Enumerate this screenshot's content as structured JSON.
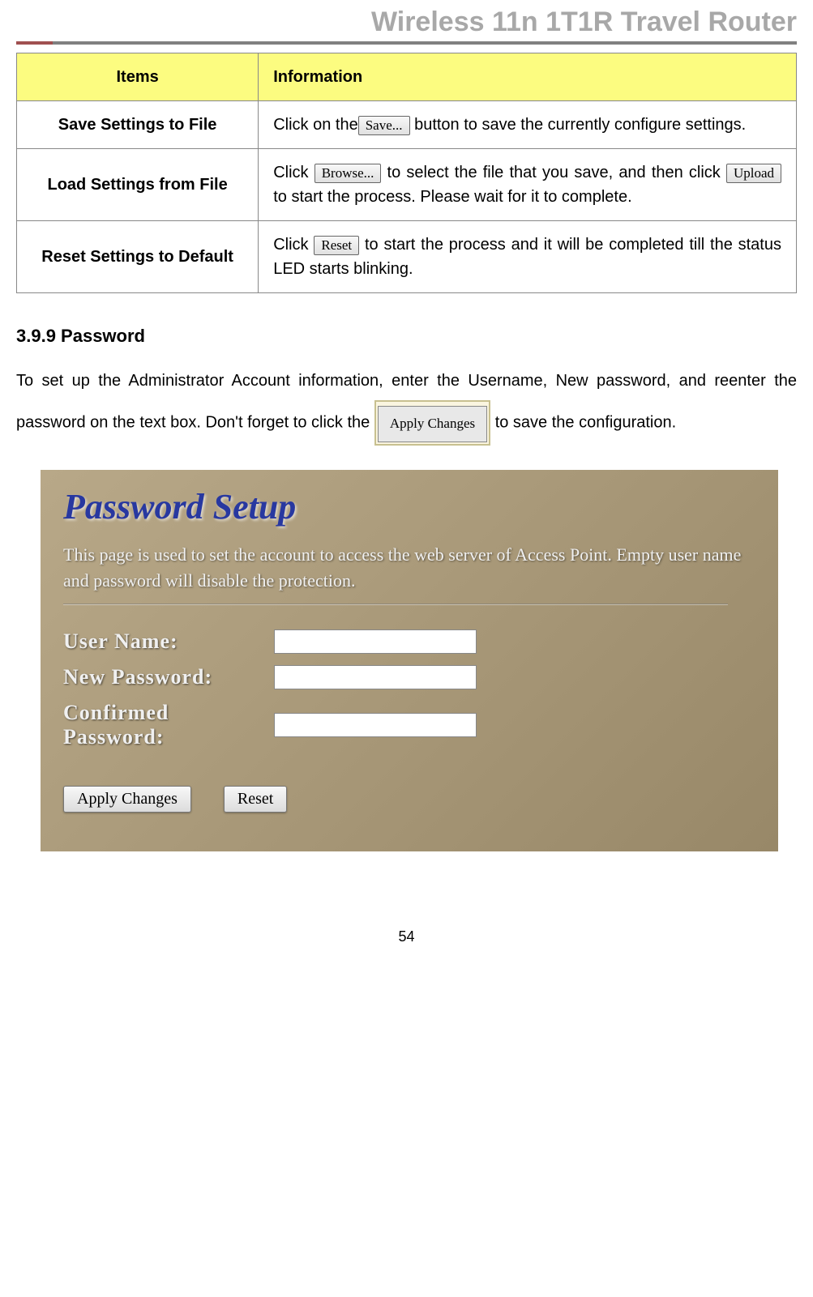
{
  "header": {
    "title": "Wireless 11n 1T1R Travel Router"
  },
  "table": {
    "headers": {
      "items": "Items",
      "info": "Information"
    },
    "rows": [
      {
        "item": "Save Settings to File",
        "info_before": "Click on the",
        "btn1": "Save...",
        "info_after": " button to save the currently configure settings."
      },
      {
        "item": "Load Settings from File",
        "info_part1": "Click ",
        "btn1": "Browse...",
        "info_part2": " to select the file that you save, and then click ",
        "btn2": "Upload",
        "info_part3": " to start the process. Please wait for it to complete."
      },
      {
        "item": "Reset Settings to Default",
        "info_before": "Click ",
        "btn1": "Reset",
        "info_after": " to start the process and it will be completed till the status LED starts blinking."
      }
    ]
  },
  "section": {
    "heading": "3.9.9   Password",
    "text_part1": "To set up the Administrator Account information, enter the Username, New password, and reenter the password on the text box. Don't forget to click the ",
    "apply_btn": "Apply Changes",
    "text_part2": " to save the configuration."
  },
  "screenshot": {
    "title": "Password Setup",
    "desc": "This page is used to set the account to access the web server of Access Point. Empty user name and password will disable the protection.",
    "labels": {
      "username": "User Name:",
      "newpass": "New Password:",
      "confirm": "Confirmed Password:"
    },
    "buttons": {
      "apply": "Apply Changes",
      "reset": "Reset"
    }
  },
  "page_number": "54"
}
